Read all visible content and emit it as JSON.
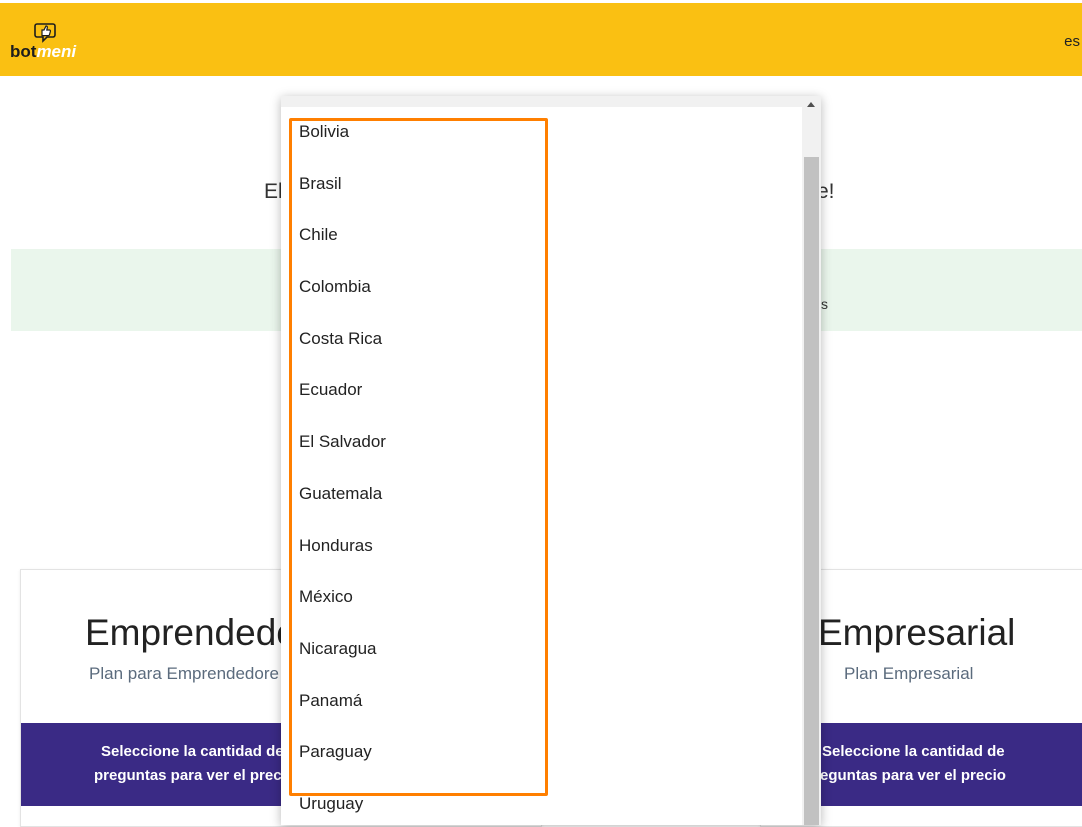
{
  "header": {
    "logo": {
      "part1": "bot",
      "part2": "meni"
    },
    "language": "es",
    "color": "#fac012"
  },
  "hero": {
    "visible_left": "El",
    "visible_right": "e!"
  },
  "notice": {
    "visible_fragment": "s"
  },
  "plans": [
    {
      "title": "Emprendedo",
      "subtitle": "Plan para Emprendedore",
      "band_line1": "Seleccione la cantidad de",
      "band_line2": "preguntas para ver el precio"
    },
    {
      "title": "Empresarial",
      "subtitle": "Plan Empresarial",
      "band_line1": "Seleccione la cantidad de",
      "band_line2": "preguntas para ver el precio"
    }
  ],
  "country_dropdown": {
    "options": [
      "Bolivia",
      "Brasil",
      "Chile",
      "Colombia",
      "Costa Rica",
      "Ecuador",
      "El Salvador",
      "Guatemala",
      "Honduras",
      "México",
      "Nicaragua",
      "Panamá",
      "Paraguay",
      "Uruguay"
    ]
  },
  "colors": {
    "accent": "#fac012",
    "band": "#3a2a85",
    "highlight": "#ff7f00",
    "notice_bg": "#eaf6ec"
  }
}
